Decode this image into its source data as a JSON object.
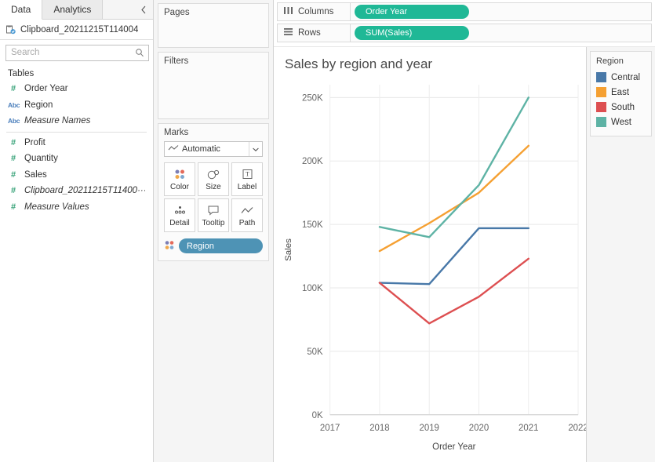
{
  "data_pane": {
    "tabs": [
      {
        "label": "Data",
        "active": true
      },
      {
        "label": "Analytics",
        "active": false
      }
    ],
    "collapse_icon": "chevron-left-icon",
    "datasource": {
      "name": "Clipboard_20211215T114004",
      "icon": "database-icon"
    },
    "search": {
      "placeholder": "Search",
      "value": ""
    },
    "toolbar": [
      {
        "icon": "search-icon"
      },
      {
        "icon": "filter-icon"
      },
      {
        "icon": "grid-view-icon"
      },
      {
        "icon": "caret-down-icon"
      }
    ],
    "tables_label": "Tables",
    "fields": [
      {
        "label": "Order Year",
        "type": "number",
        "italic": false
      },
      {
        "label": "Region",
        "type": "abc",
        "italic": false
      },
      {
        "label": "Measure Names",
        "type": "abc",
        "italic": true
      },
      {
        "label": "Profit",
        "type": "number",
        "italic": false,
        "separator_before": true
      },
      {
        "label": "Quantity",
        "type": "number",
        "italic": false
      },
      {
        "label": "Sales",
        "type": "number",
        "italic": false
      },
      {
        "label": "Clipboard_20211215T11400···",
        "type": "number",
        "italic": true
      },
      {
        "label": "Measure Values",
        "type": "number",
        "italic": true
      }
    ]
  },
  "shelf_pane": {
    "pages": {
      "title": "Pages"
    },
    "filters": {
      "title": "Filters"
    },
    "marks": {
      "title": "Marks",
      "mark_type": {
        "label": "Automatic",
        "icon": "line-chart-icon",
        "caret": "caret-down-icon"
      },
      "buttons": [
        {
          "label": "Color",
          "icon": "color-dots-icon"
        },
        {
          "label": "Size",
          "icon": "size-circles-icon"
        },
        {
          "label": "Label",
          "icon": "label-text-icon"
        },
        {
          "label": "Detail",
          "icon": "detail-dots-icon"
        },
        {
          "label": "Tooltip",
          "icon": "tooltip-bubble-icon"
        },
        {
          "label": "Path",
          "icon": "path-line-icon"
        }
      ],
      "pill": {
        "label": "Region",
        "icon": "color-dots-icon",
        "color": "#4e93b5"
      }
    }
  },
  "shelves": {
    "columns": {
      "label": "Columns",
      "icon": "columns-icon",
      "pill": "Order Year"
    },
    "rows": {
      "label": "Rows",
      "icon": "rows-icon",
      "pill": "SUM(Sales)"
    },
    "pill_color": "#1fb896"
  },
  "legend": {
    "title": "Region",
    "items": [
      {
        "label": "Central",
        "color": "#4878a8"
      },
      {
        "label": "East",
        "color": "#f5a032"
      },
      {
        "label": "South",
        "color": "#dd4f51"
      },
      {
        "label": "West",
        "color": "#5eb3a5"
      }
    ]
  },
  "chart_data": {
    "type": "line",
    "title": "Sales by region and year",
    "xlabel": "Order Year",
    "ylabel": "Sales",
    "x": [
      2018,
      2019,
      2020,
      2021
    ],
    "xlim": [
      2017,
      2022
    ],
    "xticks": [
      "2017",
      "2018",
      "2019",
      "2020",
      "2021",
      "2022"
    ],
    "xtick_values": [
      2017,
      2018,
      2019,
      2020,
      2021,
      2022
    ],
    "ylim": [
      0,
      260000
    ],
    "yticks": [
      "0K",
      "50K",
      "100K",
      "150K",
      "200K",
      "250K"
    ],
    "ytick_values": [
      0,
      50000,
      100000,
      150000,
      200000,
      250000
    ],
    "grid": true,
    "legend_position": "right",
    "series": [
      {
        "name": "Central",
        "color": "#4878a8",
        "values": [
          104000,
          103000,
          147000,
          147000
        ]
      },
      {
        "name": "East",
        "color": "#f5a032",
        "values": [
          129000,
          151000,
          175000,
          212000
        ]
      },
      {
        "name": "South",
        "color": "#dd4f51",
        "values": [
          104000,
          72000,
          93000,
          123000
        ]
      },
      {
        "name": "West",
        "color": "#5eb3a5",
        "values": [
          148000,
          140000,
          181000,
          250000
        ]
      }
    ]
  }
}
